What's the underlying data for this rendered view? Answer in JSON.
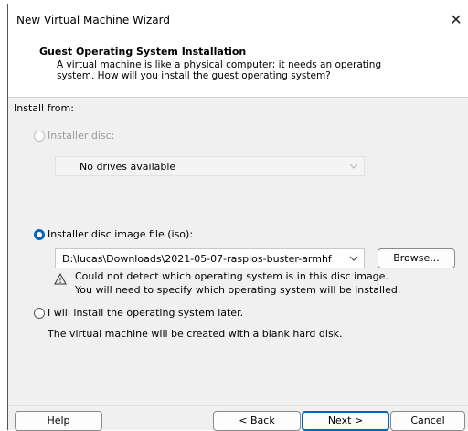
{
  "window": {
    "title": "New Virtual Machine Wizard",
    "close_glyph": "✕"
  },
  "header": {
    "title": "Guest Operating System Installation",
    "description_line1": "A virtual machine is like a physical computer; it needs an operating",
    "description_line2": "system. How will you install the guest operating system?"
  },
  "install_from_label": "Install from:",
  "options": {
    "disc": {
      "label": "Installer disc:",
      "dropdown_value": "No drives available",
      "selected": false,
      "enabled": false
    },
    "iso": {
      "label": "Installer disc image file (iso):",
      "path_value": "D:\\lucas\\Downloads\\2021-05-07-raspios-buster-armhf",
      "browse_label": "Browse...",
      "selected": true,
      "warning_line1": "Could not detect which operating system is in this disc image.",
      "warning_line2": "You will need to specify which operating system will be installed."
    },
    "later": {
      "label": "I will install the operating system later.",
      "description": "The virtual machine will be created with a blank hard disk.",
      "selected": false
    }
  },
  "buttons": {
    "help": "Help",
    "back": "< Back",
    "next": "Next >",
    "cancel": "Cancel"
  },
  "colors": {
    "accent": "#0067c0",
    "dialog_bg": "#f0f0f0",
    "header_bg": "#ffffff"
  },
  "icons": {
    "close": "close-icon",
    "warning": "warning-icon",
    "dropdown": "chevron-down-icon"
  }
}
